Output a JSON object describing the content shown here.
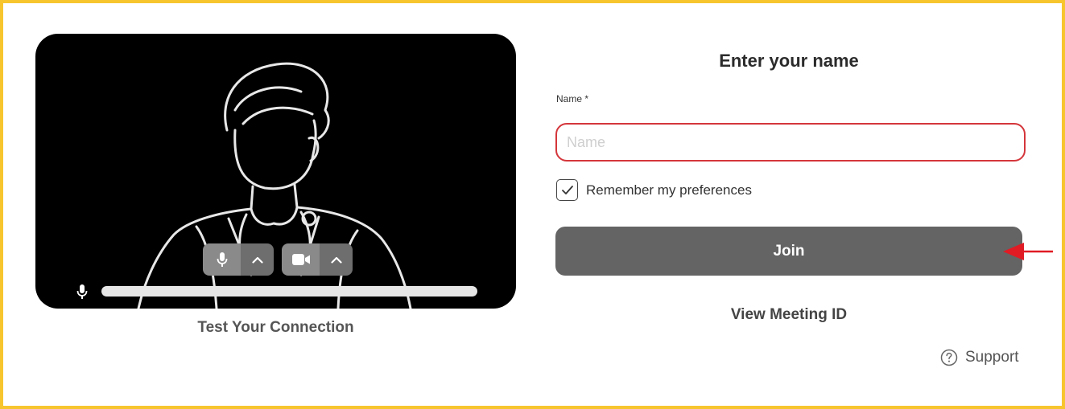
{
  "preview": {
    "test_connection_label": "Test Your Connection",
    "mic_icon": "microphone-icon",
    "camera_icon": "video-camera-icon",
    "caret_icon": "chevron-up-icon",
    "audio_level": 0.0
  },
  "form": {
    "title": "Enter your name",
    "name_label": "Name *",
    "name_placeholder": "Name",
    "name_value": "",
    "remember_label": "Remember my preferences",
    "remember_checked": true,
    "join_label": "Join",
    "view_meeting_id_label": "View Meeting ID",
    "support_label": "Support"
  },
  "colors": {
    "frame_border": "#f7c62f",
    "input_border": "#d4363b",
    "join_button": "#646464",
    "annotation_arrow": "#e01b24"
  }
}
